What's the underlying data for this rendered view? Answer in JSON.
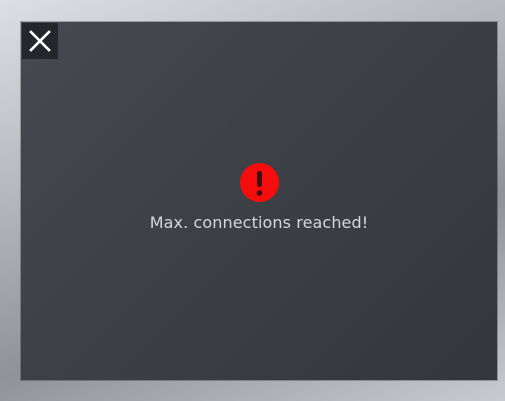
{
  "dialog": {
    "message": "Max. connections reached!",
    "close_icon": "close-icon",
    "alert_icon": "alert-icon",
    "alert_symbol": "!",
    "colors": {
      "background": "#3f4348",
      "close_button_bg": "#23262a",
      "alert": "#f50c0c",
      "message_text": "#d4d7db"
    }
  }
}
